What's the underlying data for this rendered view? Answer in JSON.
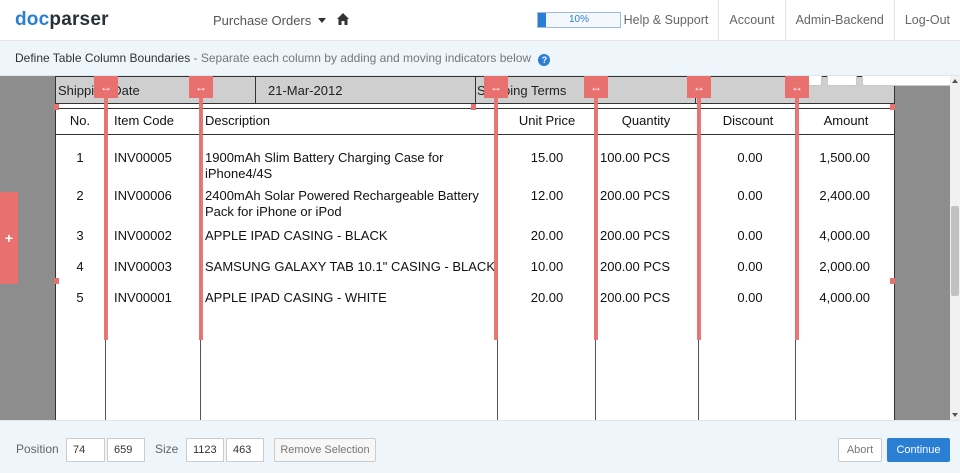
{
  "app": {
    "logo_part1": "doc",
    "logo_part2": "parser",
    "accent_color": "#2a7fd4",
    "marker_color": "#e8716f"
  },
  "nav": {
    "purchase_orders": "Purchase Orders",
    "home_icon": "home-icon",
    "progress_label": "10%",
    "progress_value": 0.1,
    "links": [
      "Help & Support",
      "Account",
      "Admin-Backend",
      "Log-Out"
    ]
  },
  "instructions": {
    "title": "Define Table Column Boundaries",
    "subtitle": " - Separate each column by adding and moving indicators below",
    "help_icon": "question-circle-icon"
  },
  "document": {
    "header_strip": {
      "shipping_date_label": "Shipping Date",
      "shipping_date_value": "21-Mar-2012",
      "shipping_terms_label": "Shipping Terms"
    },
    "columns": [
      "No.",
      "Item Code",
      "Description",
      "Unit Price",
      "Quantity",
      "Discount",
      "Amount"
    ],
    "rows": [
      {
        "no": "1",
        "code": "INV00005",
        "desc": "1900mAh Slim Battery Charging Case for iPhone4/4S",
        "price": "15.00",
        "qty": "100.00 PCS",
        "disc": "0.00",
        "amount": "1,500.00"
      },
      {
        "no": "2",
        "code": "INV00006",
        "desc": "2400mAh Solar Powered Rechargeable Battery Pack for iPhone or iPod",
        "price": "12.00",
        "qty": "200.00 PCS",
        "disc": "0.00",
        "amount": "2,400.00"
      },
      {
        "no": "3",
        "code": "INV00002",
        "desc": "APPLE IPAD CASING - BLACK",
        "price": "20.00",
        "qty": "200.00 PCS",
        "disc": "0.00",
        "amount": "4,000.00"
      },
      {
        "no": "4",
        "code": "INV00003",
        "desc": "SAMSUNG GALAXY TAB 10.1\" CASING - BLACK",
        "price": "10.00",
        "qty": "200.00 PCS",
        "disc": "0.00",
        "amount": "2,000.00"
      },
      {
        "no": "5",
        "code": "INV00001",
        "desc": "APPLE IPAD CASING - WHITE",
        "price": "20.00",
        "qty": "200.00 PCS",
        "disc": "0.00",
        "amount": "4,000.00"
      }
    ],
    "marker_handle_icon": "resize-horizontal-icon",
    "marker_handle_glyph": "↔",
    "add_column_glyph": "+"
  },
  "footer": {
    "position_label": "Position",
    "position_x": "74",
    "position_y": "659",
    "size_label": "Size",
    "size_w": "1123",
    "size_h": "463",
    "remove_label": "Remove Selection",
    "abort_label": "Abort",
    "continue_label": "Continue"
  }
}
